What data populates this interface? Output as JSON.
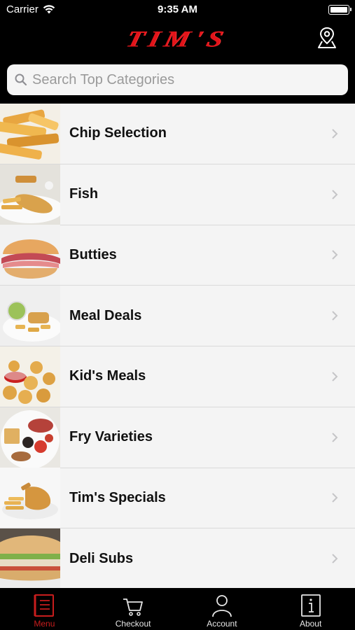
{
  "status_bar": {
    "carrier": "Carrier",
    "time": "9:35 AM"
  },
  "header": {
    "logo_text": "TIM'S",
    "brand_color": "#e2141a"
  },
  "search": {
    "placeholder": "Search Top Categories"
  },
  "categories": [
    {
      "label": "Chip Selection"
    },
    {
      "label": "Fish"
    },
    {
      "label": "Butties"
    },
    {
      "label": "Meal Deals"
    },
    {
      "label": "Kid's Meals"
    },
    {
      "label": "Fry Varieties"
    },
    {
      "label": "Tim's Specials"
    },
    {
      "label": "Deli Subs"
    }
  ],
  "tabs": [
    {
      "label": "Menu",
      "icon": "menu-icon",
      "active": true
    },
    {
      "label": "Checkout",
      "icon": "cart-icon",
      "active": false
    },
    {
      "label": "Account",
      "icon": "user-icon",
      "active": false
    },
    {
      "label": "About",
      "icon": "info-icon",
      "active": false
    }
  ],
  "colors": {
    "active_tab": "#c81d1d",
    "background": "#000000",
    "list_background": "#f4f4f4"
  }
}
